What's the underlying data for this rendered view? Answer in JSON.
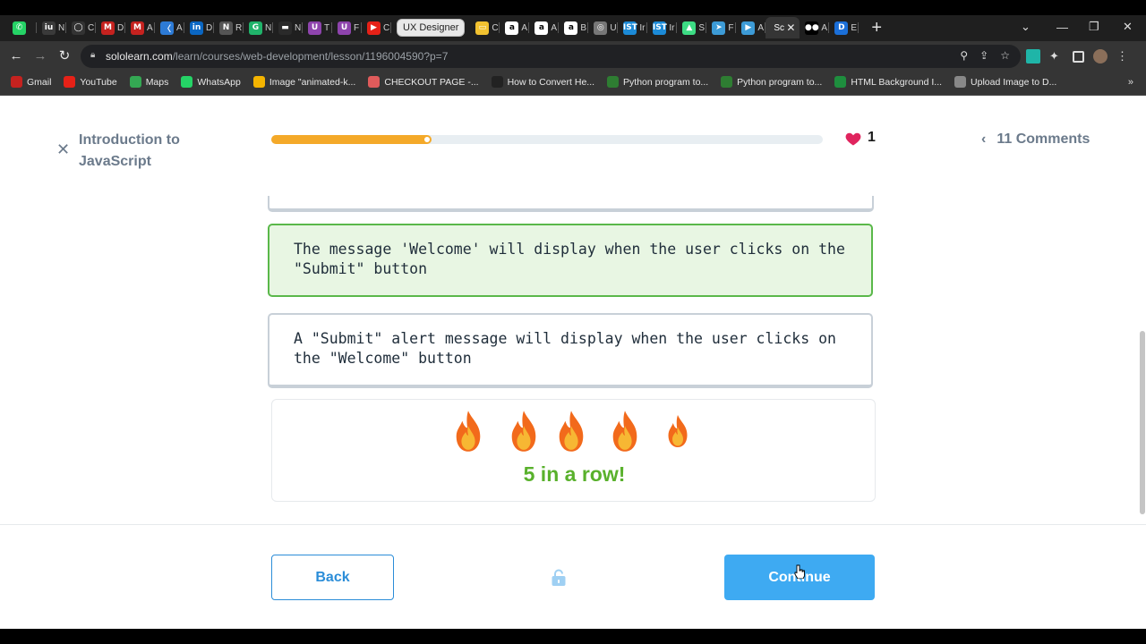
{
  "browser": {
    "tabs": [
      {
        "short": "",
        "color": "#25d366",
        "glyph": "✆"
      },
      {
        "short": "N",
        "color": "#3a3a3a",
        "glyph": "iu"
      },
      {
        "short": "C",
        "color": "#333",
        "glyph": "◯"
      },
      {
        "short": "D",
        "color": "#c5221f",
        "glyph": "M"
      },
      {
        "short": "A",
        "color": "#c5221f",
        "glyph": "M"
      },
      {
        "short": "A",
        "color": "#2d7bd6",
        "glyph": "〈"
      },
      {
        "short": "D",
        "color": "#0a66c2",
        "glyph": "in"
      },
      {
        "short": "R",
        "color": "#555",
        "glyph": "N"
      },
      {
        "short": "N",
        "color": "#20b36a",
        "glyph": "G"
      },
      {
        "short": "N",
        "color": "#2a2a2a",
        "glyph": "▬"
      },
      {
        "short": "T",
        "color": "#8e44ad",
        "glyph": "U"
      },
      {
        "short": "F",
        "color": "#8e44ad",
        "glyph": "U"
      },
      {
        "short": "C",
        "color": "#e62117",
        "glyph": "▶"
      }
    ],
    "tab_group_label": "UX Designer",
    "tabs_after": [
      {
        "short": "C",
        "color": "#f2c230",
        "glyph": "▭"
      },
      {
        "short": "A",
        "color": "#ffffff",
        "glyph": "a"
      },
      {
        "short": "A",
        "color": "#ffffff",
        "glyph": "a"
      },
      {
        "short": "B",
        "color": "#ffffff",
        "glyph": "a"
      },
      {
        "short": "U",
        "color": "#777",
        "glyph": "◎"
      },
      {
        "short": "Ir",
        "color": "#1c8ad6",
        "glyph": "IST"
      },
      {
        "short": "Ir",
        "color": "#1c8ad6",
        "glyph": "IST"
      },
      {
        "short": "S",
        "color": "#3ddc84",
        "glyph": "▲"
      },
      {
        "short": "F",
        "color": "#3d9bd6",
        "glyph": "➤"
      },
      {
        "short": "A",
        "color": "#3d9bd6",
        "glyph": "▶"
      }
    ],
    "active_tab_short": "Sc",
    "tabs_end": [
      {
        "short": "A",
        "color": "#000",
        "glyph": "●●"
      },
      {
        "short": "E",
        "color": "#1b6fd8",
        "glyph": "D"
      }
    ],
    "url_domain": "sololearn.com",
    "url_path": "/learn/courses/web-development/lesson/1196004590?p=7",
    "bookmarks": [
      {
        "label": "Gmail",
        "color": "#c5221f"
      },
      {
        "label": "YouTube",
        "color": "#e62117"
      },
      {
        "label": "Maps",
        "color": "#34a853"
      },
      {
        "label": "WhatsApp",
        "color": "#25d366"
      },
      {
        "label": "Image \"animated-k...",
        "color": "#f4b400"
      },
      {
        "label": "CHECKOUT PAGE -...",
        "color": "#e05b5b"
      },
      {
        "label": "How to Convert He...",
        "color": "#222"
      },
      {
        "label": "Python program to...",
        "color": "#2e7d32"
      },
      {
        "label": "Python program to...",
        "color": "#2e7d32"
      },
      {
        "label": "HTML Background I...",
        "color": "#1e8e3e"
      },
      {
        "label": "Upload Image to D...",
        "color": "#888"
      }
    ],
    "bookmarks_more": "»"
  },
  "lesson": {
    "course_title": "Introduction to JavaScript",
    "progress": 0.29,
    "lives": "1",
    "comments_label": "11 Comments",
    "options": [
      {
        "text": "The message 'Welcome' will display when the user clicks on the \"Submit\" button",
        "state": "correct"
      },
      {
        "text": "A \"Submit\" alert message will display when the user clicks on the \"Welcome\" button",
        "state": "default"
      }
    ],
    "streak_label": "5 in a row!",
    "back_label": "Back",
    "continue_label": "Continue"
  },
  "colors": {
    "progress_fill": "#f4a929",
    "correct_border": "#5ab84a",
    "correct_bg": "#e8f6e3",
    "streak_green": "#59b12c",
    "primary_blue": "#3eaaf2",
    "heart_red": "#e0245e"
  }
}
